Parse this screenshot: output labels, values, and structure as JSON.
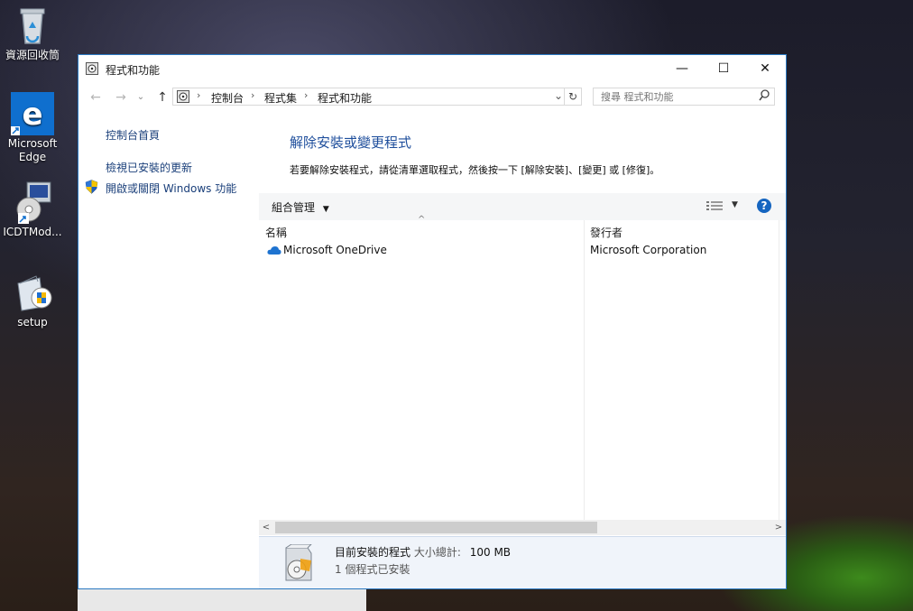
{
  "desktop": {
    "icons": [
      {
        "label": "資源回收筒"
      },
      {
        "label": "Microsoft Edge"
      },
      {
        "label": "ICDTMod..."
      },
      {
        "label": "setup"
      }
    ]
  },
  "window": {
    "title": "程式和功能",
    "controls": {
      "minimize": "—",
      "maximize": "☐",
      "close": "✕"
    }
  },
  "address": {
    "breadcrumbs": [
      "控制台",
      "程式集",
      "程式和功能"
    ],
    "separator": "›",
    "search_placeholder": "搜尋 程式和功能"
  },
  "left_nav": {
    "items": [
      {
        "label": "控制台首頁"
      },
      {
        "label": "檢視已安裝的更新"
      },
      {
        "label": "開啟或關閉 Windows 功能"
      }
    ]
  },
  "main": {
    "title": "解除安裝或變更程式",
    "description": "若要解除安裝程式，請從清單選取程式，然後按一下 [解除安裝]、[變更] 或 [修復]。"
  },
  "toolbar": {
    "organize_label": "組合管理",
    "help_label": "?"
  },
  "table": {
    "columns": [
      "名稱",
      "發行者"
    ],
    "rows": [
      {
        "name": "Microsoft OneDrive",
        "publisher": "Microsoft Corporation"
      }
    ]
  },
  "details": {
    "title": "目前安裝的程式",
    "size_label": "大小總計:",
    "size_value": "100 MB",
    "count_text": "1 個程式已安裝"
  },
  "colors": {
    "accent": "#2b79c2",
    "link": "#1a3f7a",
    "heading": "#1e4e9c",
    "help": "#1565c0"
  }
}
